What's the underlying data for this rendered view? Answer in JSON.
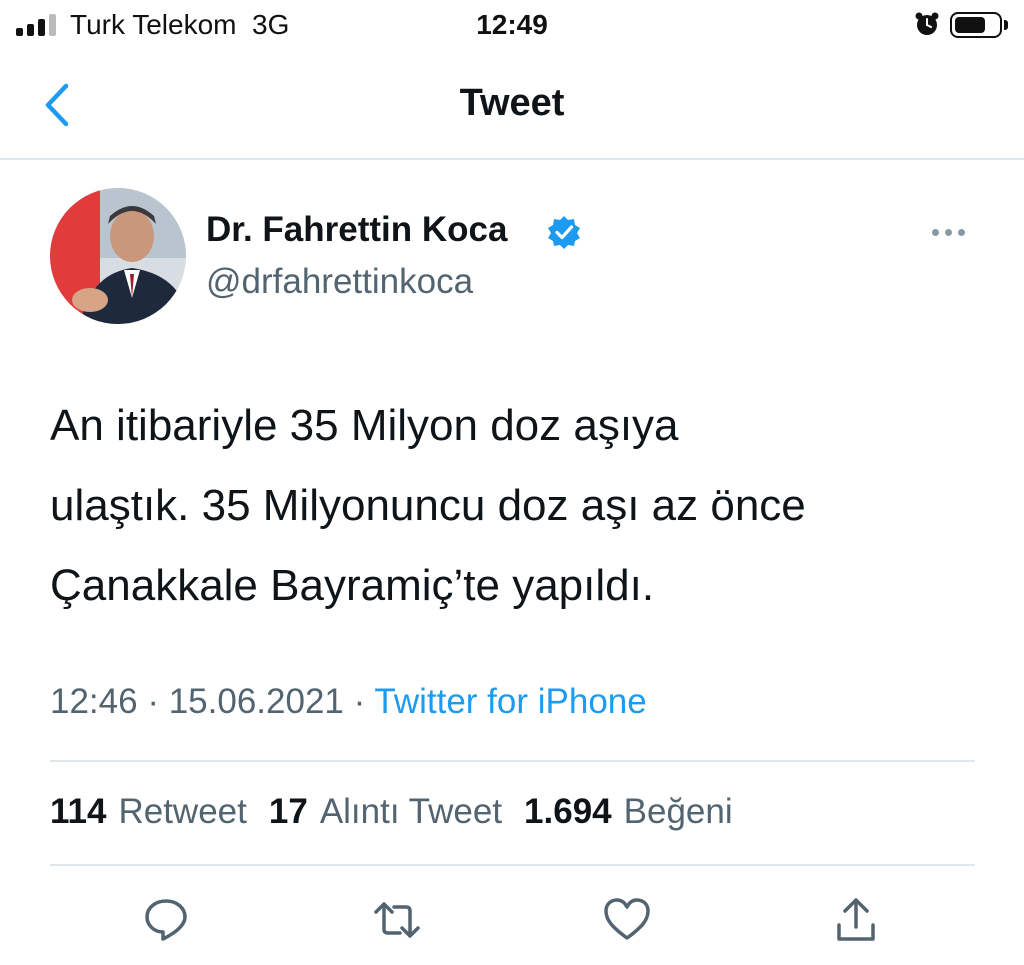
{
  "status_bar": {
    "carrier": "Turk Telekom  3G",
    "time": "12:49",
    "icons": [
      "signal-icon",
      "alarm-icon",
      "battery-icon"
    ]
  },
  "header": {
    "title": "Tweet",
    "back_icon": "chevron-left-icon"
  },
  "author": {
    "name": "Dr. Fahrettin Koca",
    "handle": "@drfahrettinkoca",
    "verified": true
  },
  "tweet": {
    "lines": [
      "An itibariyle 35 Milyon doz aşıya",
      "ulaştık. 35 Milyonuncu doz aşı az önce",
      "Çanakkale Bayramiç’te yapıldı."
    ],
    "time": "12:46",
    "date": "15.06.2021",
    "separator": "·",
    "source": "Twitter for iPhone"
  },
  "stats": {
    "retweets": {
      "count": "114",
      "label": "Retweet"
    },
    "quotes": {
      "count": "17",
      "label": "Alıntı Tweet"
    },
    "likes": {
      "count": "1.694",
      "label": "Beğeni"
    }
  },
  "actions": [
    "reply-icon",
    "retweet-icon",
    "like-icon",
    "share-icon"
  ],
  "colors": {
    "accent": "#1d9bf0",
    "text": "#0f1419",
    "secondary": "#536471",
    "divider": "#e1e6ea"
  }
}
